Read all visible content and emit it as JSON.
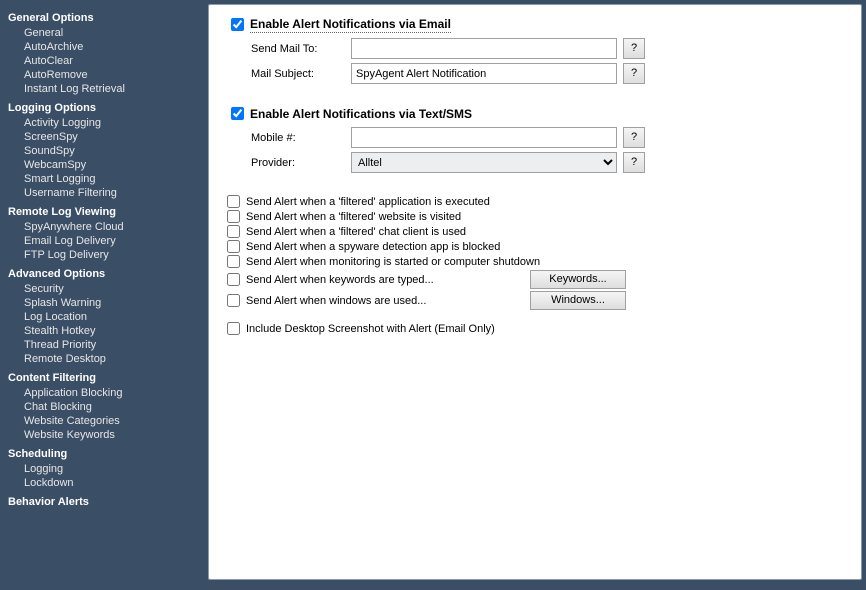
{
  "sidebar": [
    {
      "title": "General Options",
      "items": [
        "General",
        "AutoArchive",
        "AutoClear",
        "AutoRemove",
        "Instant Log Retrieval"
      ]
    },
    {
      "title": "Logging Options",
      "items": [
        "Activity Logging",
        "ScreenSpy",
        "SoundSpy",
        "WebcamSpy",
        "Smart Logging",
        "Username Filtering"
      ]
    },
    {
      "title": "Remote Log Viewing",
      "items": [
        "SpyAnywhere Cloud",
        "Email Log Delivery",
        "FTP Log Delivery"
      ]
    },
    {
      "title": "Advanced Options",
      "items": [
        "Security",
        "Splash Warning",
        "Log Location",
        "Stealth Hotkey",
        "Thread Priority",
        "Remote Desktop"
      ]
    },
    {
      "title": "Content Filtering",
      "items": [
        "Application Blocking",
        "Chat Blocking",
        "Website Categories",
        "Website Keywords"
      ]
    },
    {
      "title": "Scheduling",
      "items": [
        "Logging",
        "Lockdown"
      ]
    },
    {
      "title": "Behavior Alerts",
      "items": []
    }
  ],
  "email": {
    "enable_label": "Enable Alert Notifications via Email",
    "send_to_label": "Send Mail To:",
    "send_to_value": "",
    "subject_label": "Mail Subject:",
    "subject_value": "SpyAgent Alert Notification"
  },
  "sms": {
    "enable_label": "Enable Alert Notifications via Text/SMS",
    "mobile_label": "Mobile #:",
    "mobile_value": "",
    "provider_label": "Provider:",
    "provider_value": "Alltel"
  },
  "help_label": "?",
  "alerts": [
    "Send Alert when a 'filtered' application is executed",
    "Send Alert when a 'filtered' website is visited",
    "Send Alert when a 'filtered' chat client is used",
    "Send Alert when a spyware detection app is blocked",
    "Send Alert when monitoring is started or computer shutdown"
  ],
  "kw_row": {
    "label": "Send Alert when keywords are typed...",
    "button": "Keywords..."
  },
  "win_row": {
    "label": "Send Alert when windows are used...",
    "button": "Windows..."
  },
  "include_screenshot": "Include Desktop Screenshot with Alert (Email Only)"
}
